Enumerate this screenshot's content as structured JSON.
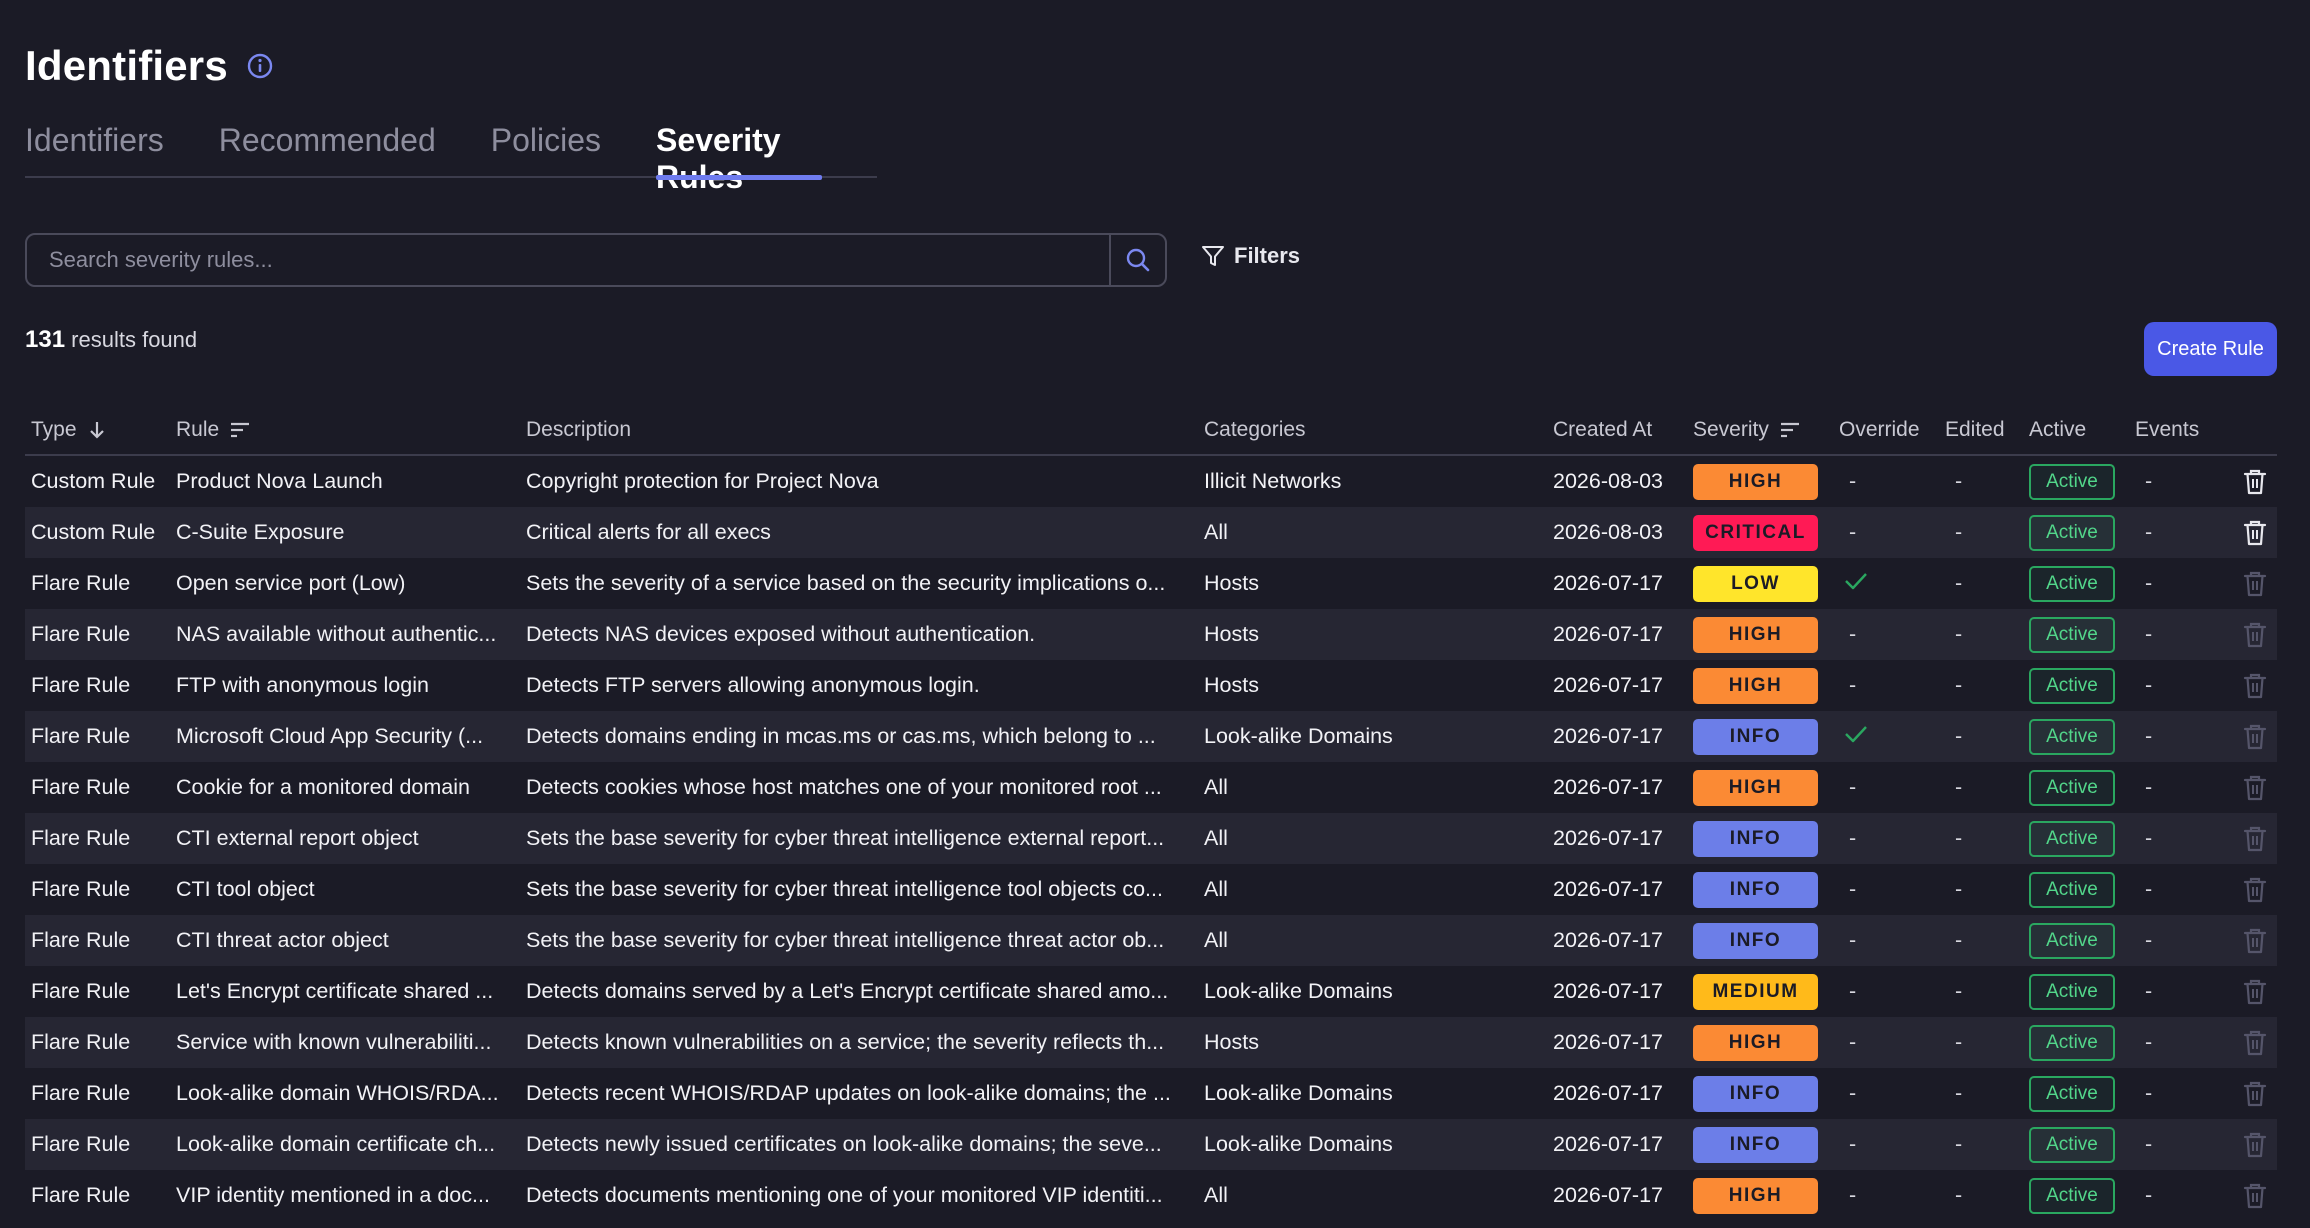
{
  "header": {
    "title": "Identifiers"
  },
  "tabs": [
    {
      "label": "Identifiers",
      "active": false
    },
    {
      "label": "Recommended",
      "active": false
    },
    {
      "label": "Policies",
      "active": false
    },
    {
      "label": "Severity Rules",
      "active": true
    }
  ],
  "search": {
    "placeholder": "Search severity rules...",
    "value": ""
  },
  "filters": {
    "label": "Filters"
  },
  "results": {
    "count": "131",
    "suffix": "results found"
  },
  "create_button": {
    "label": "Create Rule"
  },
  "columns": {
    "type": "Type",
    "rule": "Rule",
    "description": "Description",
    "categories": "Categories",
    "created_at": "Created At",
    "severity": "Severity",
    "override": "Override",
    "edited": "Edited",
    "active": "Active",
    "events": "Events"
  },
  "colors": {
    "HIGH": "#fb8a34",
    "CRITICAL": "#ff1a55",
    "LOW": "#ffe52b",
    "INFO": "#6c7ee8",
    "MEDIUM": "#ffba1a",
    "accent": "#4a58e6"
  },
  "rows": [
    {
      "type": "Custom Rule",
      "rule": "Product Nova Launch",
      "description": "Copyright protection for Project Nova",
      "categories": "Illicit Networks",
      "created_at": "2026-08-03",
      "severity": "HIGH",
      "override": "-",
      "edited": "-",
      "active": "Active",
      "events": "-",
      "deletable": true
    },
    {
      "type": "Custom Rule",
      "rule": "C-Suite Exposure",
      "description": "Critical alerts for all execs",
      "categories": "All",
      "created_at": "2026-08-03",
      "severity": "CRITICAL",
      "override": "-",
      "edited": "-",
      "active": "Active",
      "events": "-",
      "deletable": true
    },
    {
      "type": "Flare Rule",
      "rule": "Open service port (Low)",
      "description": "Sets the severity of a service based on the security implications o...",
      "categories": "Hosts",
      "created_at": "2026-07-17",
      "severity": "LOW",
      "override": "check",
      "edited": "-",
      "active": "Active",
      "events": "-",
      "deletable": false
    },
    {
      "type": "Flare Rule",
      "rule": "NAS available without authentic...",
      "description": "Detects NAS devices exposed without authentication.",
      "categories": "Hosts",
      "created_at": "2026-07-17",
      "severity": "HIGH",
      "override": "-",
      "edited": "-",
      "active": "Active",
      "events": "-",
      "deletable": false
    },
    {
      "type": "Flare Rule",
      "rule": "FTP with anonymous login",
      "description": "Detects FTP servers allowing anonymous login.",
      "categories": "Hosts",
      "created_at": "2026-07-17",
      "severity": "HIGH",
      "override": "-",
      "edited": "-",
      "active": "Active",
      "events": "-",
      "deletable": false
    },
    {
      "type": "Flare Rule",
      "rule": "Microsoft Cloud App Security (...",
      "description": "Detects domains ending in mcas.ms or cas.ms, which belong to ...",
      "categories": "Look-alike Domains",
      "created_at": "2026-07-17",
      "severity": "INFO",
      "override": "check",
      "edited": "-",
      "active": "Active",
      "events": "-",
      "deletable": false
    },
    {
      "type": "Flare Rule",
      "rule": "Cookie for a monitored domain",
      "description": "Detects cookies whose host matches one of your monitored root ...",
      "categories": "All",
      "created_at": "2026-07-17",
      "severity": "HIGH",
      "override": "-",
      "edited": "-",
      "active": "Active",
      "events": "-",
      "deletable": false
    },
    {
      "type": "Flare Rule",
      "rule": "CTI external report object",
      "description": "Sets the base severity for cyber threat intelligence external report...",
      "categories": "All",
      "created_at": "2026-07-17",
      "severity": "INFO",
      "override": "-",
      "edited": "-",
      "active": "Active",
      "events": "-",
      "deletable": false
    },
    {
      "type": "Flare Rule",
      "rule": "CTI tool object",
      "description": "Sets the base severity for cyber threat intelligence tool objects co...",
      "categories": "All",
      "created_at": "2026-07-17",
      "severity": "INFO",
      "override": "-",
      "edited": "-",
      "active": "Active",
      "events": "-",
      "deletable": false
    },
    {
      "type": "Flare Rule",
      "rule": "CTI threat actor object",
      "description": "Sets the base severity for cyber threat intelligence threat actor ob...",
      "categories": "All",
      "created_at": "2026-07-17",
      "severity": "INFO",
      "override": "-",
      "edited": "-",
      "active": "Active",
      "events": "-",
      "deletable": false
    },
    {
      "type": "Flare Rule",
      "rule": "Let's Encrypt certificate shared ...",
      "description": "Detects domains served by a Let's Encrypt certificate shared amo...",
      "categories": "Look-alike Domains",
      "created_at": "2026-07-17",
      "severity": "MEDIUM",
      "override": "-",
      "edited": "-",
      "active": "Active",
      "events": "-",
      "deletable": false
    },
    {
      "type": "Flare Rule",
      "rule": "Service with known vulnerabiliti...",
      "description": "Detects known vulnerabilities on a service; the severity reflects th...",
      "categories": "Hosts",
      "created_at": "2026-07-17",
      "severity": "HIGH",
      "override": "-",
      "edited": "-",
      "active": "Active",
      "events": "-",
      "deletable": false
    },
    {
      "type": "Flare Rule",
      "rule": "Look-alike domain WHOIS/RDA...",
      "description": "Detects recent WHOIS/RDAP updates on look-alike domains; the ...",
      "categories": "Look-alike Domains",
      "created_at": "2026-07-17",
      "severity": "INFO",
      "override": "-",
      "edited": "-",
      "active": "Active",
      "events": "-",
      "deletable": false
    },
    {
      "type": "Flare Rule",
      "rule": "Look-alike domain certificate ch...",
      "description": "Detects newly issued certificates on look-alike domains; the seve...",
      "categories": "Look-alike Domains",
      "created_at": "2026-07-17",
      "severity": "INFO",
      "override": "-",
      "edited": "-",
      "active": "Active",
      "events": "-",
      "deletable": false
    },
    {
      "type": "Flare Rule",
      "rule": "VIP identity mentioned in a doc...",
      "description": "Detects documents mentioning one of your monitored VIP identiti...",
      "categories": "All",
      "created_at": "2026-07-17",
      "severity": "HIGH",
      "override": "-",
      "edited": "-",
      "active": "Active",
      "events": "-",
      "deletable": false
    }
  ]
}
